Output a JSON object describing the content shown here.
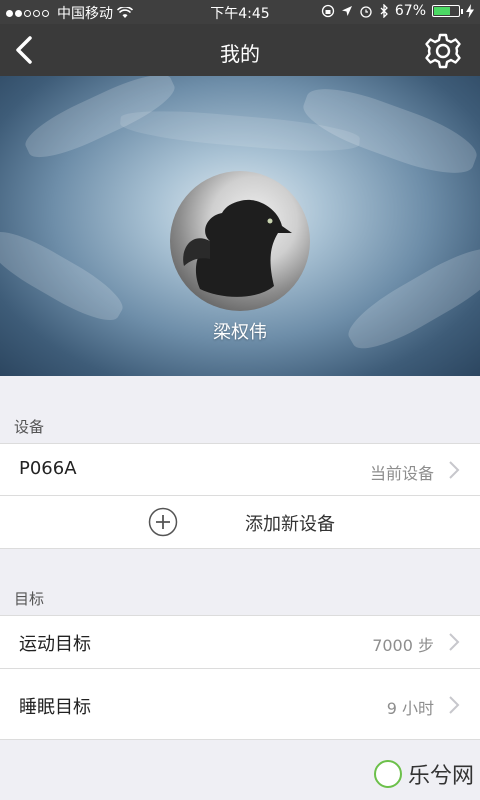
{
  "status_bar": {
    "carrier": "中国移动",
    "time": "下午4:45",
    "battery_percent": "67%",
    "battery_level": 0.67,
    "signal_dots_filled": 2,
    "icons": [
      "wifi-icon",
      "lock-rotation-icon",
      "location-icon",
      "alarm-icon",
      "bluetooth-icon",
      "charging-icon"
    ]
  },
  "nav": {
    "title": "我的",
    "back_icon": "back-chevron-icon",
    "settings_icon": "gear-icon"
  },
  "profile": {
    "username": "梁权伟"
  },
  "devices_section": {
    "label": "设备",
    "device_name": "P066A",
    "device_status": "当前设备",
    "add_device_label": "添加新设备"
  },
  "goals_section": {
    "label": "目标",
    "items": [
      {
        "label": "运动目标",
        "value": "7000 步"
      },
      {
        "label": "睡眠目标",
        "value": "9 小时"
      }
    ]
  },
  "watermark": {
    "text": "乐兮网"
  },
  "colors": {
    "nav_bg": "#3a3a3a",
    "page_bg": "#efeff4",
    "accent_green": "#4cd964"
  }
}
